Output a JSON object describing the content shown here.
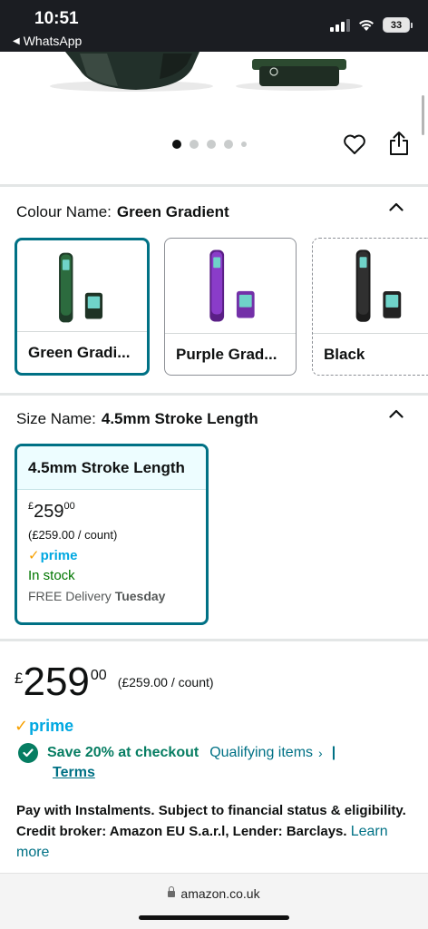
{
  "status_bar": {
    "time": "10:51",
    "back_app": "WhatsApp",
    "battery": "33",
    "icons": [
      "signal-icon",
      "wifi-icon",
      "battery-icon"
    ]
  },
  "gallery": {
    "dot_count": 5,
    "active_dot": 1,
    "icons": [
      "heart-icon",
      "share-icon"
    ]
  },
  "colour": {
    "label": "Colour Name:",
    "selected": "Green Gradient",
    "options": [
      {
        "name": "Green Gradi...",
        "color": "#1f5a33"
      },
      {
        "name": "Purple Grad...",
        "color": "#7e2fb5"
      },
      {
        "name": "Black",
        "color": "#2a2a2a"
      }
    ]
  },
  "size": {
    "label": "Size Name:",
    "selected": "4.5mm Stroke Length",
    "card": {
      "title": "4.5mm Stroke Length",
      "currency": "£",
      "whole": "259",
      "fraction": "00",
      "per_count": "(£259.00 / count)",
      "prime": "prime",
      "stock": "In stock",
      "delivery_prefix": "FREE Delivery",
      "delivery_day": "Tuesday"
    }
  },
  "buybox": {
    "currency": "£",
    "whole": "259",
    "fraction": "00",
    "per_count": "(£259.00 / count)",
    "prime": "prime",
    "save_text": "Save 20% at checkout",
    "qualifying": "Qualifying items",
    "separator": "|",
    "terms": "Terms",
    "instalments": "Pay with Instalments. Subject to financial status & eligibility. Credit broker: Amazon EU S.a.r.l, Lender: Barclays.",
    "learn_more": "Learn more"
  },
  "browser": {
    "url": "amazon.co.uk"
  },
  "colors": {
    "teal": "#007185",
    "green": "#067d62",
    "prime_blue": "#00a8e1",
    "stock_green": "#007600"
  }
}
